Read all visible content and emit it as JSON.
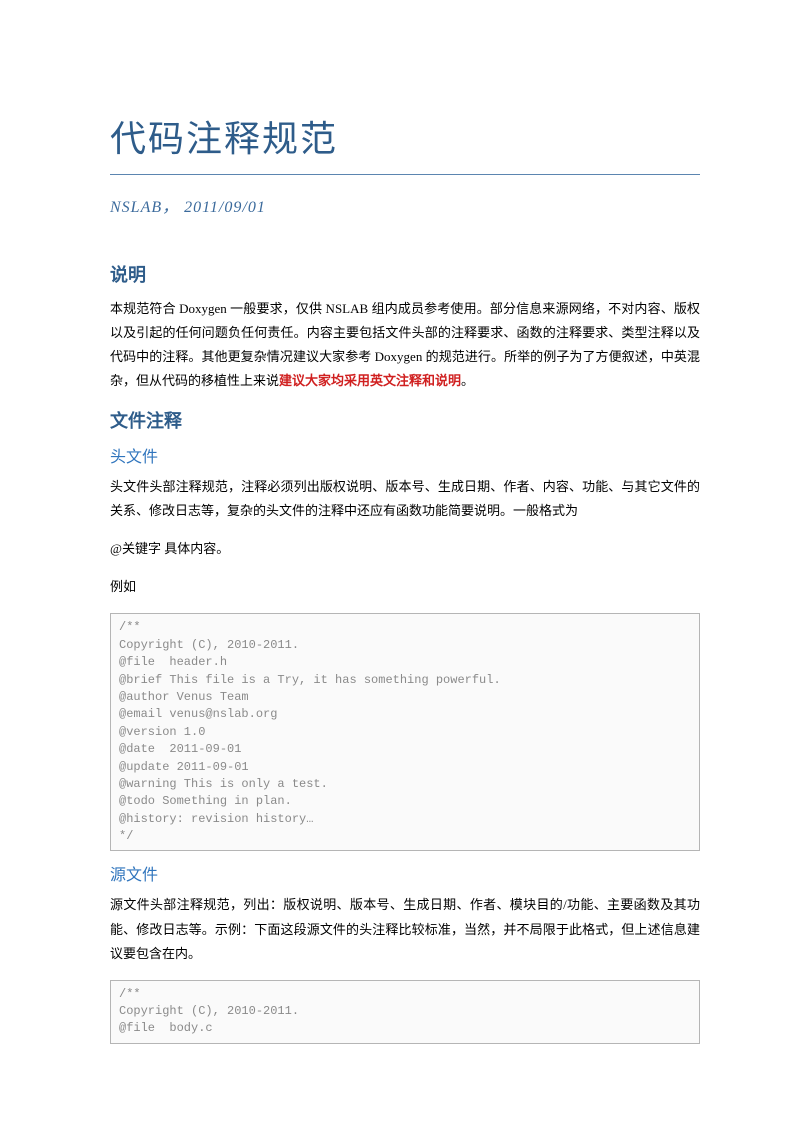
{
  "title": "代码注释规范",
  "subtitle": "NSLAB， 2011/09/01",
  "sections": {
    "intro_heading": "说明",
    "intro_text_1": "本规范符合 Doxygen 一般要求，仅供 NSLAB 组内成员参考使用。部分信息来源网络，不对内容、版权以及引起的任何问题负任何责任。内容主要包括文件头部的注释要求、函数的注释要求、类型注释以及代码中的注释。其他更复杂情况建议大家参考 Doxygen 的规范进行。所举的例子为了方便叙述，中英混杂，但从代码的移植性上来说",
    "intro_text_highlight": "建议大家均采用英文注释和说明",
    "intro_text_end": "。",
    "file_heading": "文件注释",
    "header_heading": "头文件",
    "header_para": "头文件头部注释规范，注释必须列出版权说明、版本号、生成日期、作者、内容、功能、与其它文件的关系、修改日志等，复杂的头文件的注释中还应有函数功能简要说明。一般格式为",
    "header_format": "@关键字 具体内容。",
    "header_example_label": "例如",
    "header_code": "/**\nCopyright (C), 2010-2011.\n@file  header.h\n@brief This file is a Try, it has something powerful.\n@author Venus Team\n@email venus@nslab.org\n@version 1.0\n@date  2011-09-01\n@update 2011-09-01\n@warning This is only a test.\n@todo Something in plan.\n@history: revision history…\n*/",
    "source_heading": "源文件",
    "source_para": "源文件头部注释规范，列出：版权说明、版本号、生成日期、作者、模块目的/功能、主要函数及其功能、修改日志等。示例：下面这段源文件的头注释比较标准，当然，并不局限于此格式，但上述信息建议要包含在内。",
    "source_code": "/**\nCopyright (C), 2010-2011.\n@file  body.c"
  }
}
